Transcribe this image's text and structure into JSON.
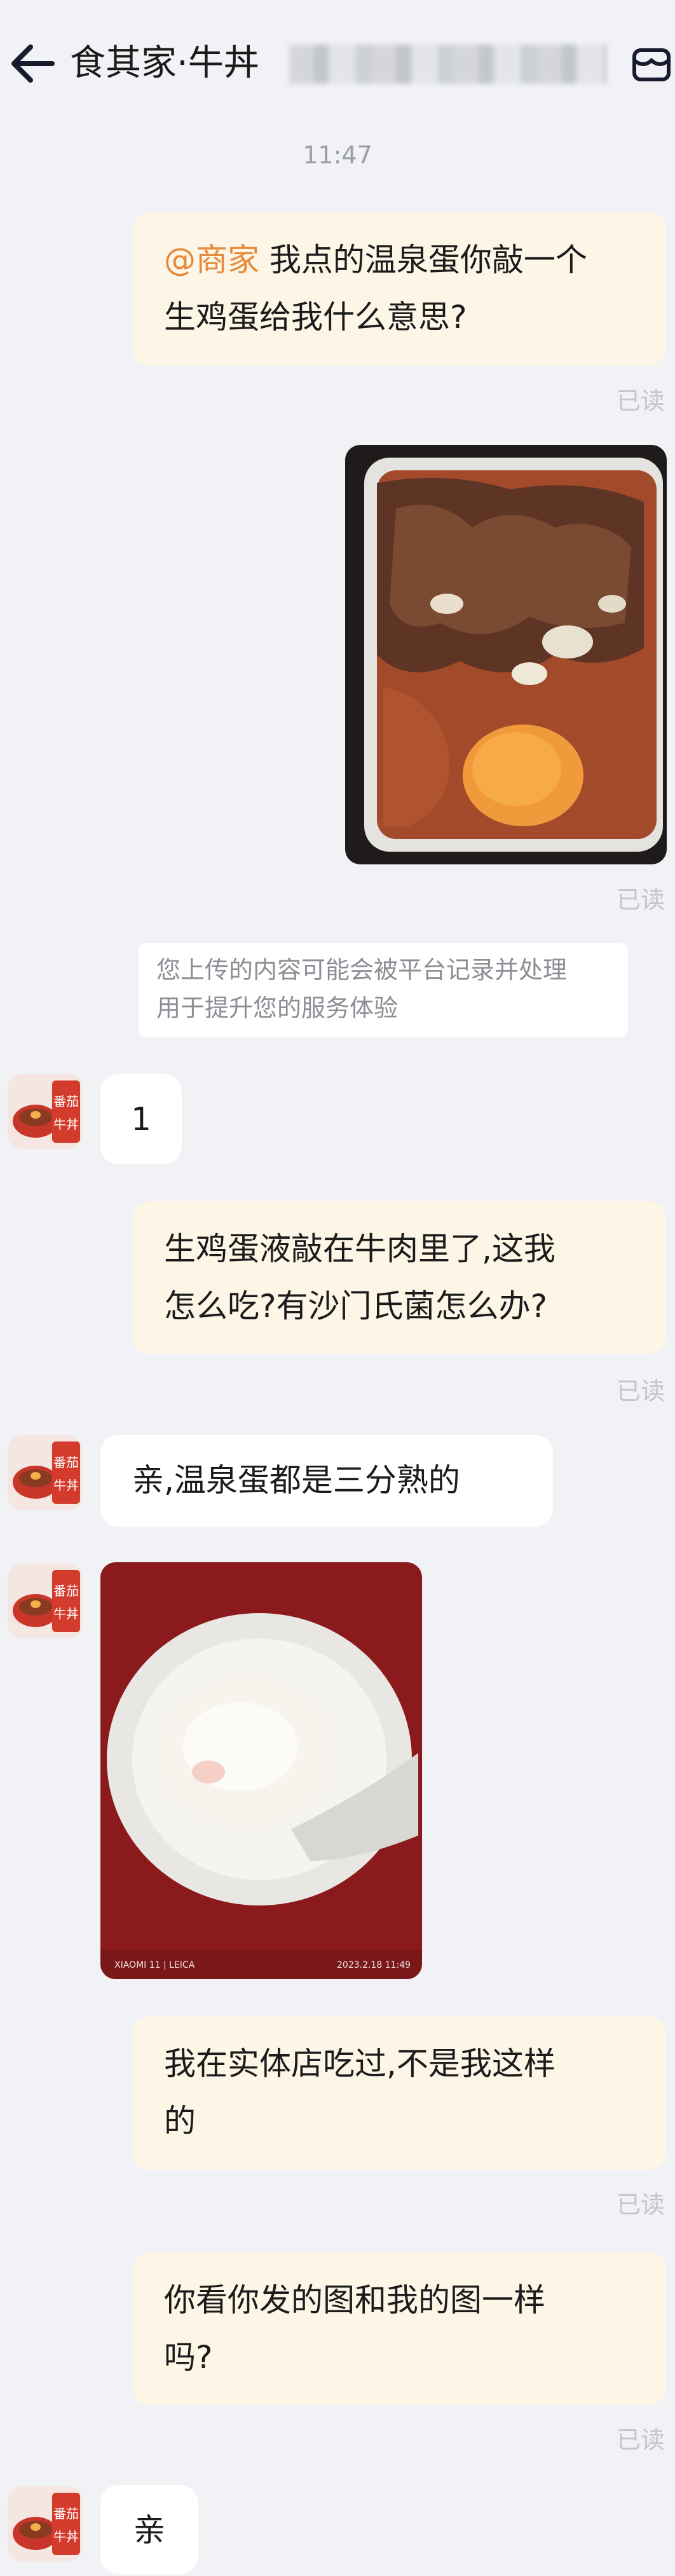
{
  "header": {
    "title": "食其家·牛丼",
    "back_icon": "arrow-left-icon",
    "shop_icon": "shop-icon"
  },
  "timestamp": "11:47",
  "messages": {
    "m1": {
      "mention": "@商家",
      "line1": " 我点的温泉蛋你敲一个",
      "line2": "生鸡蛋给我什么意思?",
      "status": "已读"
    },
    "m2": {
      "image": "beef-bowl-with-raw-egg-photo",
      "status": "已读"
    },
    "notice": {
      "line1": "您上传的内容可能会被平台记录并处理",
      "line2": "用于提升您的服务体验"
    },
    "m3": {
      "text": "1"
    },
    "m4": {
      "line1": "生鸡蛋液敲在牛肉里了,这我",
      "line2": "怎么吃?有沙门氏菌怎么办?",
      "status": "已读"
    },
    "m5": {
      "text": "亲,温泉蛋都是三分熟的"
    },
    "m6": {
      "image": "soft-boiled-egg-photo",
      "watermark_left": "XIAOMI 11 | LEICA",
      "watermark_right": "2023.2.18 11:49"
    },
    "m7": {
      "line1": "我在实体店吃过,不是我这样",
      "line2": "的",
      "status": "已读"
    },
    "m8": {
      "line1": "你看你发的图和我的图一样",
      "line2": "吗?",
      "status": "已读"
    },
    "m9": {
      "text": "亲"
    }
  },
  "avatar": {
    "label_top": "番茄",
    "label_bottom": "牛丼"
  },
  "colors": {
    "background": "#f0f2f5",
    "right_bubble": "#fdf5e6",
    "left_bubble": "#ffffff",
    "mention": "#e58a3a",
    "read": "#c4c6cb"
  }
}
